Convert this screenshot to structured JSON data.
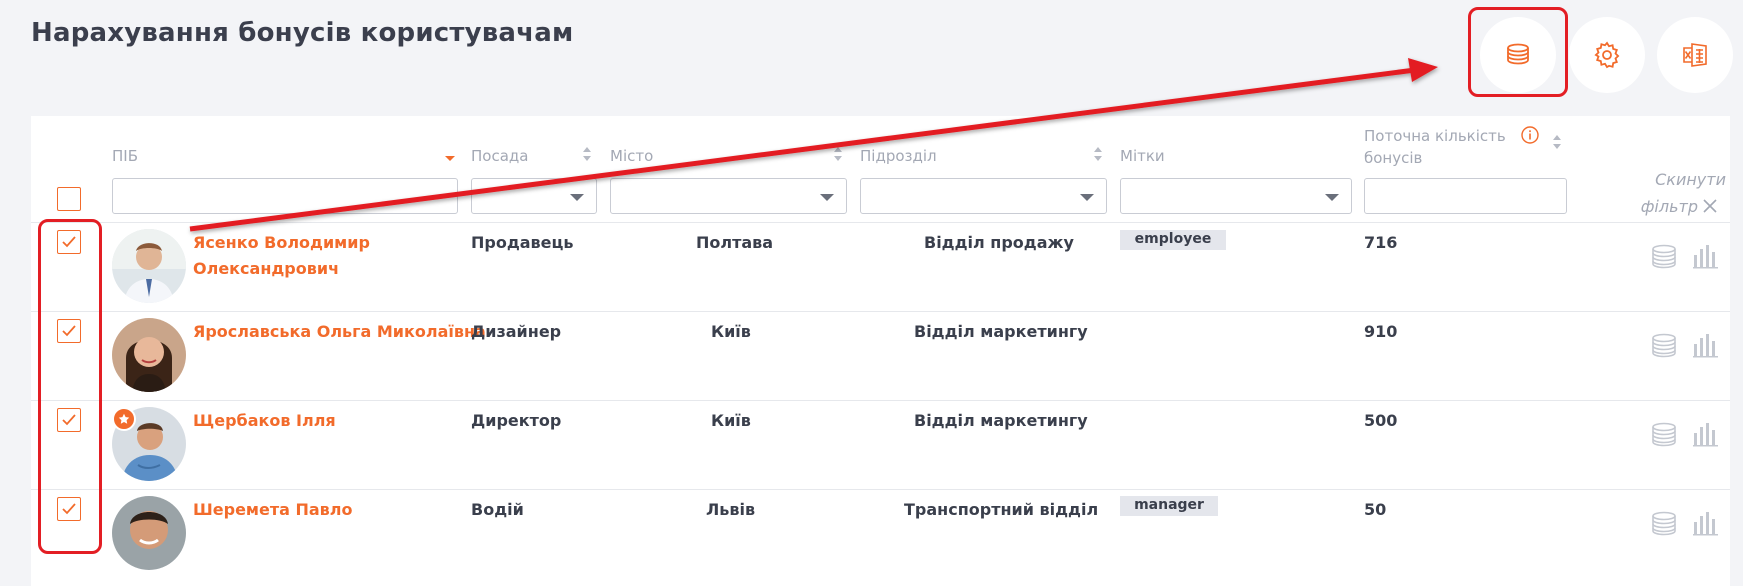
{
  "page": {
    "title": "Нарахування бонусів користувачам"
  },
  "colors": {
    "accent": "#f26b2b",
    "highlight": "#e31e24",
    "text": "#3a3f4c",
    "muted": "#a3a8b4"
  },
  "toolbar": {
    "buttons": [
      {
        "name": "accrue-bonus-button",
        "icon": "coins-icon"
      },
      {
        "name": "settings-button",
        "icon": "gear-icon"
      },
      {
        "name": "export-excel-button",
        "icon": "excel-icon"
      }
    ]
  },
  "table": {
    "columns": {
      "name": "ПІБ",
      "position": "Посада",
      "city": "Місто",
      "department": "Підрозділ",
      "tags": "Мітки",
      "bonus_line1": "Поточна кількість",
      "bonus_line2": "бонусів"
    },
    "reset_filter_line1": "Скинути",
    "reset_filter_line2": "фільтр",
    "rows": [
      {
        "name_line1": "Ясенко Володимир",
        "name_line2": "Олександрович",
        "position": "Продавець",
        "city": "Полтава",
        "department": "Відділ продажу",
        "tag": "employee",
        "bonus": "716",
        "checked": true,
        "starred": false
      },
      {
        "name_line1": "Ярославська Ольга Миколаївна",
        "name_line2": "",
        "position": "Дизайнер",
        "city": "Київ",
        "department": "Відділ маркетингу",
        "tag": "",
        "bonus": "910",
        "checked": true,
        "starred": false
      },
      {
        "name_line1": "Щербаков Ілля",
        "name_line2": "",
        "position": "Директор",
        "city": "Київ",
        "department": "Відділ маркетингу",
        "tag": "",
        "bonus": "500",
        "checked": true,
        "starred": true
      },
      {
        "name_line1": "Шеремета Павло",
        "name_line2": "",
        "position": "Водій",
        "city": "Львів",
        "department": "Транспортний відділ",
        "tag": "manager",
        "bonus": "50",
        "checked": true,
        "starred": false
      }
    ]
  }
}
